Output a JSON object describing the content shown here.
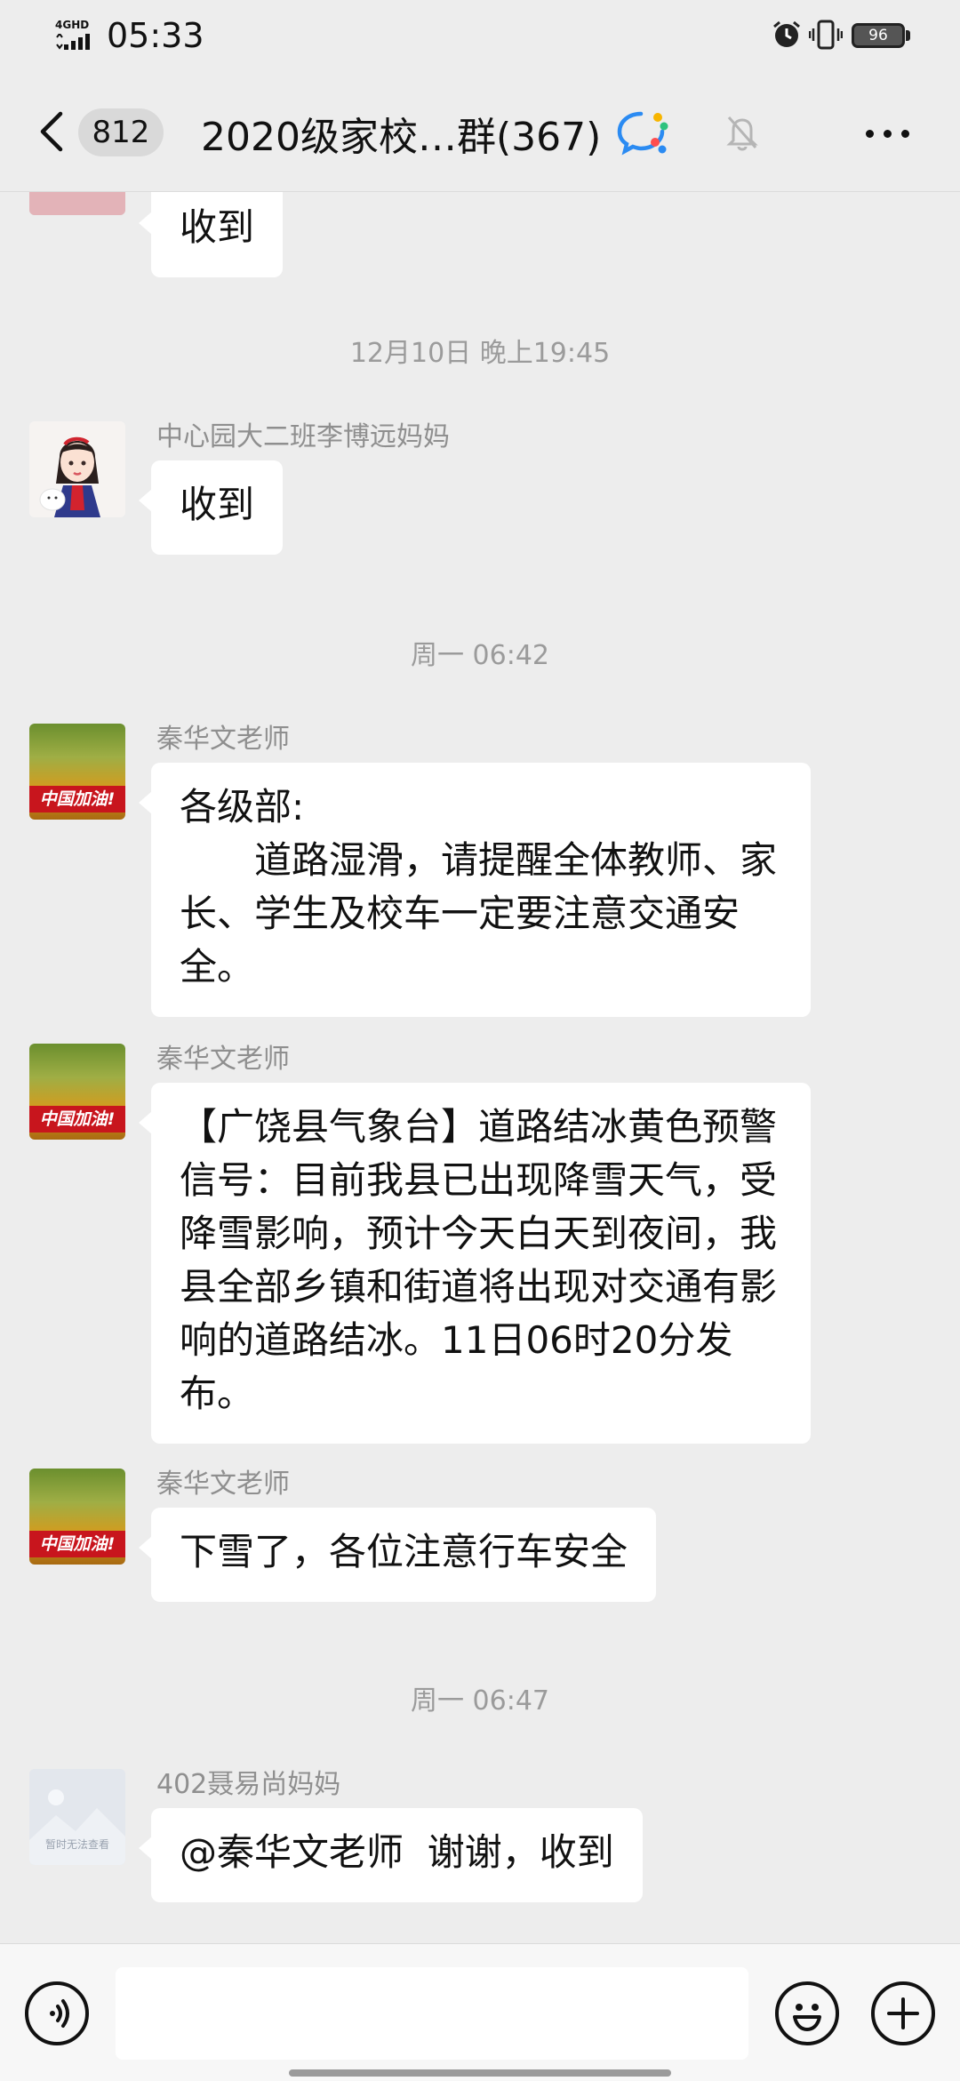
{
  "status_bar": {
    "network": "4GHD",
    "time": "05:33",
    "battery": "96"
  },
  "header": {
    "unread_count": "812",
    "title": "2020级家校…群(367)"
  },
  "messages": [
    {
      "type": "message",
      "sender": "",
      "text": "收到",
      "avatar": "photo-avatar"
    },
    {
      "type": "timestamp",
      "text": "12月10日 晚上19:45"
    },
    {
      "type": "message",
      "sender": "中心园大二班李博远妈妈",
      "text": "收到",
      "avatar": "cartoon-girl-avatar"
    },
    {
      "type": "timestamp",
      "text": "周一 06:42"
    },
    {
      "type": "message",
      "sender": "秦华文老师",
      "text": "各级部:\n　　道路湿滑，请提醒全体教师、家长、学生及校车一定要注意交通安全。",
      "avatar": "china-jiayou-avatar"
    },
    {
      "type": "message",
      "sender": "秦华文老师",
      "text": "【广饶县气象台】道路结冰黄色预警信号：目前我县已出现降雪天气，受降雪影响，预计今天白天到夜间，我县全部乡镇和街道将出现对交通有影响的道路结冰。11日06时20分发布。",
      "avatar": "china-jiayou-avatar"
    },
    {
      "type": "message",
      "sender": "秦华文老师",
      "text": "下雪了，各位注意行车安全",
      "avatar": "china-jiayou-avatar"
    },
    {
      "type": "timestamp",
      "text": "周一 06:47"
    },
    {
      "type": "message",
      "sender": "402聂易尚妈妈",
      "text": "@秦华文老师  谢谢，收到",
      "avatar": "placeholder-image-avatar"
    }
  ],
  "avatar_banner": "中国加油!",
  "placeholder_avatar_text": "暂时无法查看",
  "input": {
    "placeholder": ""
  },
  "icons": {
    "back": "chevron-left-icon",
    "chat": "chat-bubble-icon",
    "mute": "bell-off-icon",
    "more": "more-dots-icon",
    "voice": "voice-icon",
    "emoji": "emoji-icon",
    "plus": "plus-icon"
  },
  "colors": {
    "background": "#ededed",
    "bubble": "#ffffff",
    "badge": "#d9d9d9"
  }
}
